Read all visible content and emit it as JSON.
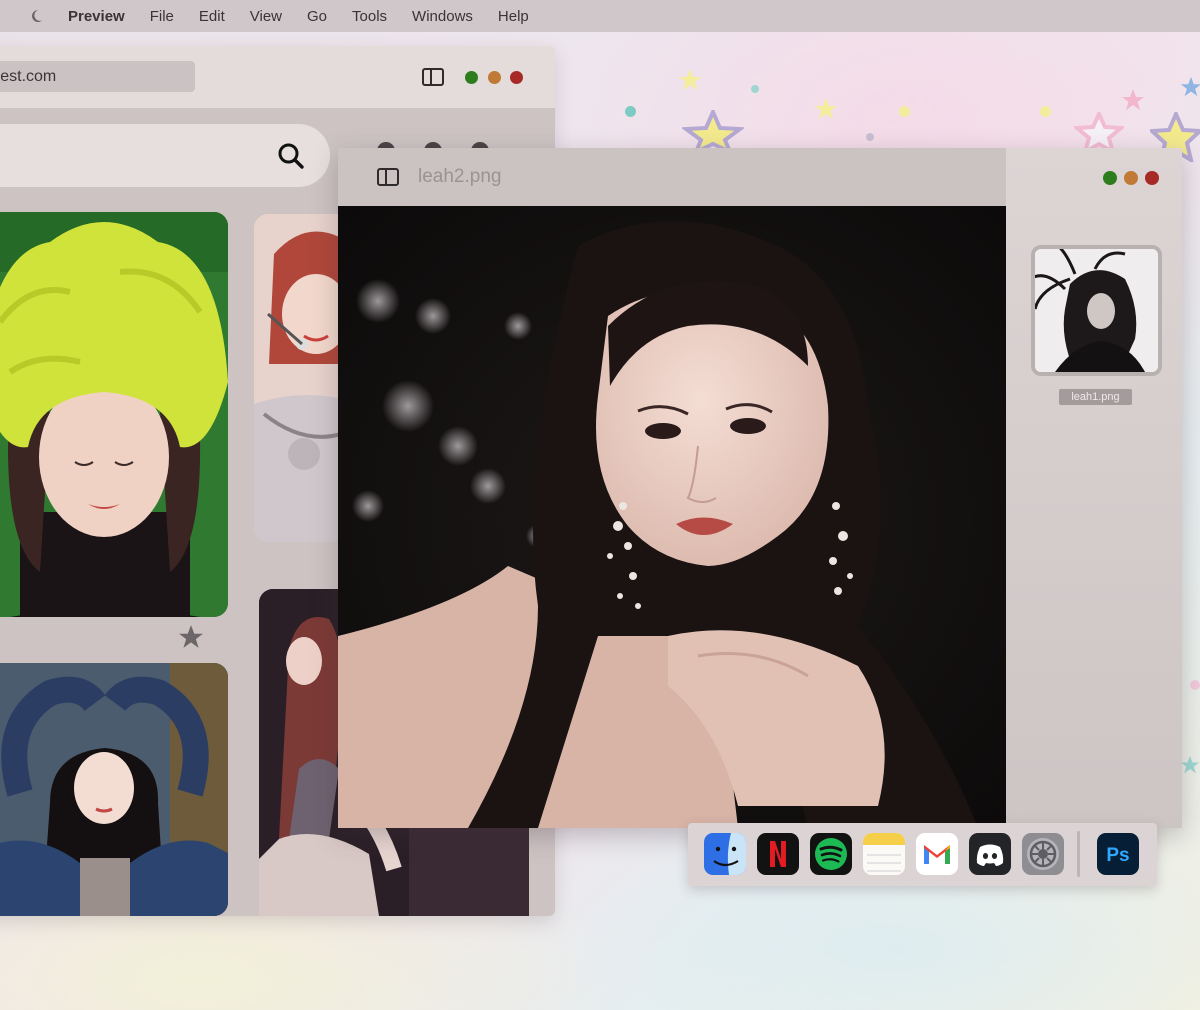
{
  "menubar": {
    "app_name": "Preview",
    "items": [
      "File",
      "Edit",
      "View",
      "Go",
      "Tools",
      "Windows",
      "Help"
    ]
  },
  "browser": {
    "url": "pinterest.com",
    "url_visible": "erest.com",
    "traffic_lights": [
      "#2e7d1d",
      "#c07a36",
      "#a82a26"
    ]
  },
  "preview": {
    "title": "leah2.png",
    "thumbnail_label": "leah1.png",
    "traffic_lights": [
      "#2e7d1d",
      "#c07a36",
      "#a82a26"
    ]
  },
  "dock": {
    "apps": [
      "finder-icon",
      "netflix-icon",
      "spotify-icon",
      "notes-icon",
      "gmail-icon",
      "discord-icon",
      "system-settings-icon",
      "photoshop-icon"
    ]
  },
  "colors": {
    "menubar": "#cfc7c9",
    "window_chrome": "#e4dcdb",
    "text": "#3a3436",
    "accent_pink": "#f0c9d8"
  }
}
